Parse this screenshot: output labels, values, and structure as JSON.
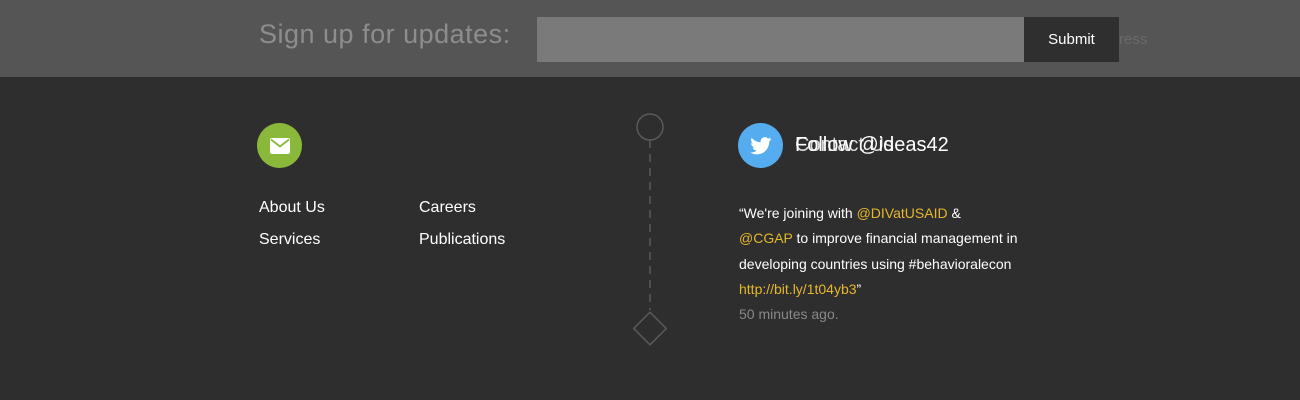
{
  "signup": {
    "label": "Sign up for updates:",
    "email_placeholder": "",
    "submit_label": "Submit",
    "hidden_text": "ress"
  },
  "footer": {
    "contact_heading": "Contact Us",
    "nav": [
      {
        "label": "About Us"
      },
      {
        "label": "Careers"
      },
      {
        "label": "Services"
      },
      {
        "label": "Publications"
      }
    ]
  },
  "twitter": {
    "heading": "Follow @ideas42",
    "tweet": {
      "open_quote": "“",
      "part1": "We're joining with ",
      "mention1": "@DIVatUSAID",
      "part2": " & ",
      "mention2": "@CGAP",
      "part3": " to improve financial management in developing countries using #behavioralecon ",
      "link": "http://bit.ly/1t04yb3",
      "close_quote": "”"
    },
    "time": "50 minutes ago."
  },
  "colors": {
    "footer_bg": "#2e2e2e",
    "signup_bg": "#555555",
    "contact_green": "#8ab83a",
    "twitter_blue": "#55acee",
    "link_gold": "#e5b72b"
  },
  "icons": {
    "contact": "envelope-icon",
    "twitter": "twitter-bird-icon"
  }
}
